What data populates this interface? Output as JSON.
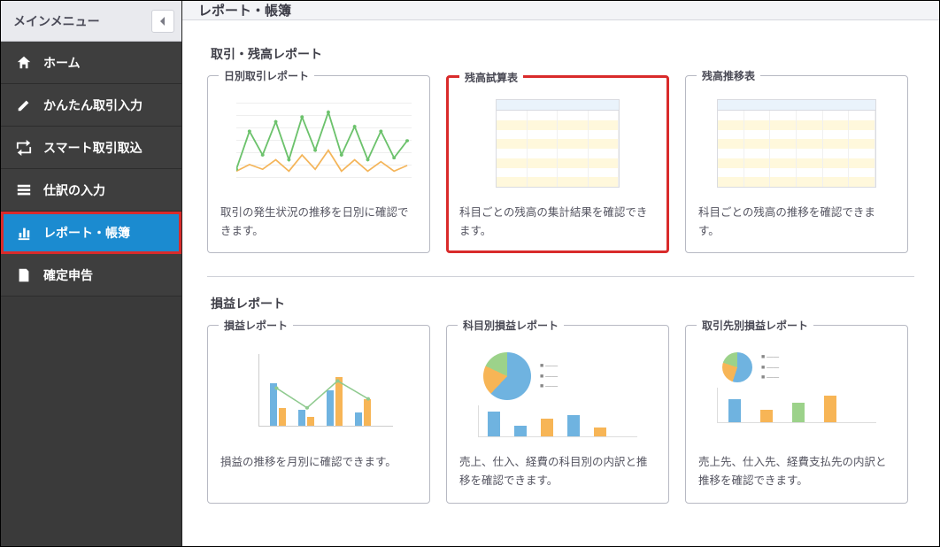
{
  "sidebar": {
    "header": "メインメニュー",
    "items": [
      {
        "label": "ホーム",
        "icon": "home"
      },
      {
        "label": "かんたん取引入力",
        "icon": "pencil"
      },
      {
        "label": "スマート取引取込",
        "icon": "import"
      },
      {
        "label": "仕訳の入力",
        "icon": "grid"
      },
      {
        "label": "レポート・帳簿",
        "icon": "chart",
        "active": true,
        "highlighted": true
      },
      {
        "label": "確定申告",
        "icon": "doc"
      }
    ]
  },
  "page": {
    "title": "レポート・帳簿"
  },
  "sections": [
    {
      "title": "取引・残高レポート",
      "cards": [
        {
          "title": "日別取引レポート",
          "desc": "取引の発生状況の推移を日別に確認できます。",
          "thumb": "line"
        },
        {
          "title": "残高試算表",
          "desc": "科目ごとの残高の集計結果を確認できます。",
          "thumb": "table",
          "highlighted": true
        },
        {
          "title": "残高推移表",
          "desc": "科目ごとの残高の推移を確認できます。",
          "thumb": "table-wide"
        }
      ]
    },
    {
      "title": "損益レポート",
      "cards": [
        {
          "title": "損益レポート",
          "desc": "損益の推移を月別に確認できます。",
          "thumb": "bar"
        },
        {
          "title": "科目別損益レポート",
          "desc": "売上、仕入、経費の科目別の内訳と推移を確認できます。",
          "thumb": "pie-bar"
        },
        {
          "title": "取引先別損益レポート",
          "desc": "売上先、仕入先、経費支払先の内訳と推移を確認できます。",
          "thumb": "pie-bar2"
        }
      ]
    }
  ]
}
